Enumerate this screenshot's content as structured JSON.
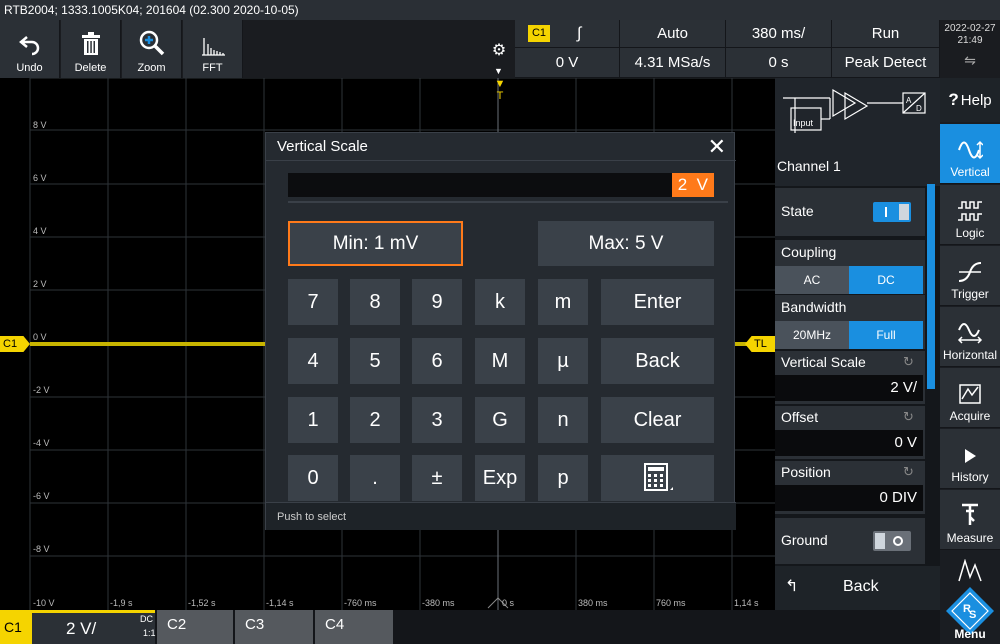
{
  "title": "RTB2004; 1333.1005K04; 201604 (02.300 2020-10-05)",
  "toolbar": {
    "tools": [
      {
        "name": "undo",
        "label": "Undo",
        "icon": "undo-icon"
      },
      {
        "name": "delete",
        "label": "Delete",
        "icon": "trash-icon"
      },
      {
        "name": "zoom",
        "label": "Zoom",
        "icon": "zoom-icon"
      },
      {
        "name": "fft",
        "label": "FFT",
        "icon": "fft-icon"
      }
    ]
  },
  "status": {
    "channel": "C1",
    "slope": "rising-edge-icon",
    "trigger_mode": "Auto",
    "timebase": "380 ms/",
    "run_state": "Run",
    "trigger_level": "0 V",
    "sample_rate": "4.31 MSa/s",
    "time_offset": "0 s",
    "acq_mode": "Peak Detect"
  },
  "datetime": {
    "date": "2022-02-27",
    "time": "21:49"
  },
  "plot": {
    "y_labels": [
      "8 V",
      "6 V",
      "4 V",
      "2 V",
      "0 V",
      "-2 V",
      "-4 V",
      "-6 V",
      "-8 V",
      "-10 V"
    ],
    "x_labels": [
      "-1,9 s",
      "-1,52 s",
      "-1,14 s",
      "-760 ms",
      "-380 ms",
      "0 s",
      "380 ms",
      "760 ms",
      "1,14 s"
    ],
    "channel_marker": "C1",
    "trigger_marker": "TL",
    "trigger_color": "#f5d400",
    "trace_color": "#c8b400"
  },
  "dialog": {
    "title": "Vertical Scale",
    "value": "2  V",
    "min_label": "Min: 1 mV",
    "max_label": "Max: 5 V",
    "keys": [
      [
        "7",
        "8",
        "9",
        "k",
        "m",
        "Enter"
      ],
      [
        "4",
        "5",
        "6",
        "M",
        "µ",
        "Back"
      ],
      [
        "1",
        "2",
        "3",
        "G",
        "n",
        "Clear"
      ],
      [
        "0",
        ".",
        "±",
        "Exp",
        "p",
        "calculator-icon"
      ]
    ],
    "footer": "Push to select"
  },
  "side": {
    "channel_title": "Channel 1",
    "diagram_input_label": "Input",
    "state_label": "State",
    "coupling_label": "Coupling",
    "coupling_options": [
      "AC",
      "DC"
    ],
    "coupling_selected": "DC",
    "bandwidth_label": "Bandwidth",
    "bandwidth_options": [
      "20MHz",
      "Full"
    ],
    "bandwidth_selected": "Full",
    "vertical_scale_label": "Vertical Scale",
    "vertical_scale_value": "2 V/",
    "offset_label": "Offset",
    "offset_value": "0 V",
    "position_label": "Position",
    "position_value": "0 DIV",
    "ground_label": "Ground",
    "back_label": "Back"
  },
  "nav": {
    "help": "Help",
    "items": [
      "Vertical",
      "Logic",
      "Trigger",
      "Horizontal",
      "Acquire",
      "History",
      "Measure"
    ],
    "menu": "Menu",
    "active": "Vertical",
    "accent": "#1a8fe0"
  },
  "bottom": {
    "c1_label": "C1",
    "c1_scale": "2 V/",
    "c1_coupling": "DC",
    "c1_probe": "1:1",
    "tabs": [
      "C2",
      "C3",
      "C4"
    ]
  }
}
